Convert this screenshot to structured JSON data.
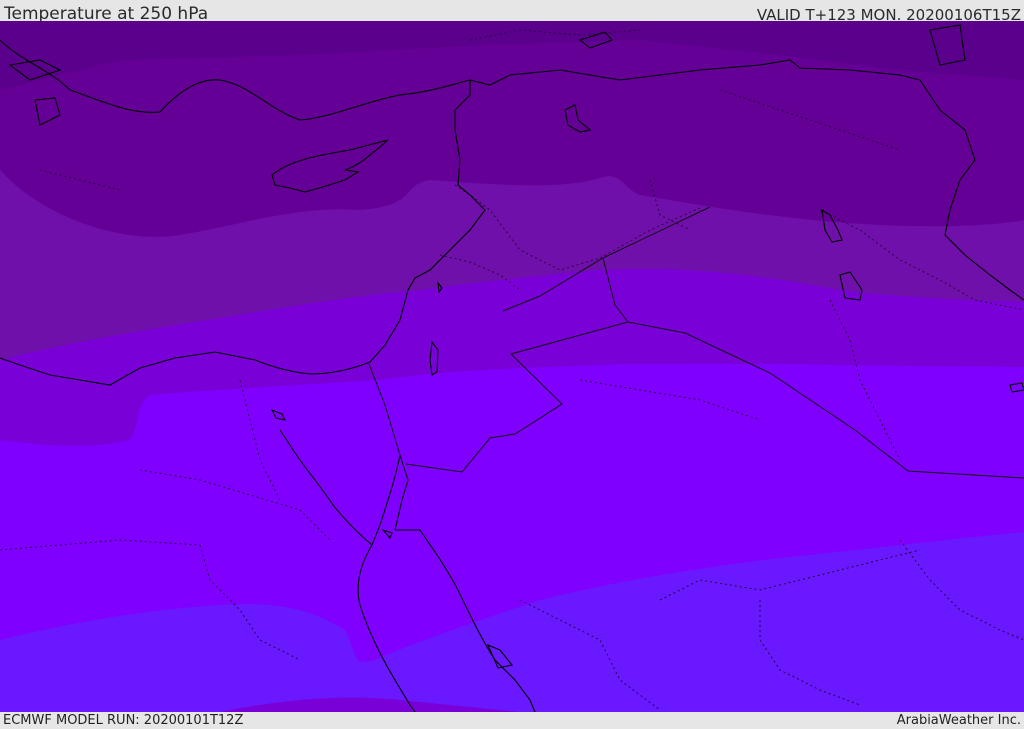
{
  "header": {
    "title": "Temperature at 250 hPa",
    "valid_time": "VALID T+123 MON. 20200106T15Z"
  },
  "footer": {
    "model_run": "ECMWF MODEL RUN: 20200101T12Z",
    "credit": "ArabiaWeather Inc."
  },
  "map": {
    "field": "temperature",
    "level": "250 hPa",
    "band_colors": [
      "#5a008c",
      "#640096",
      "#7010aa",
      "#7a00d8",
      "#8000ff",
      "#6a18ff"
    ],
    "coastline_color": "#000000",
    "border_style": "dotted"
  }
}
